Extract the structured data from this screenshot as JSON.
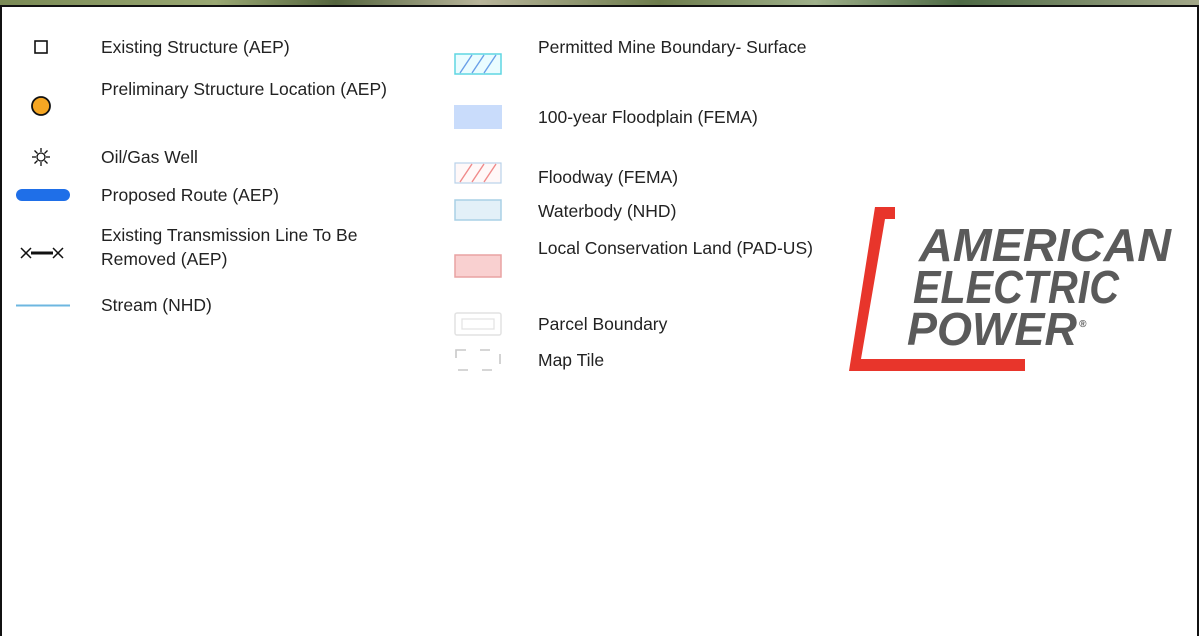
{
  "legend_left": {
    "items": [
      {
        "label": "Existing Structure (AEP)",
        "icon": "square-outline-icon"
      },
      {
        "label": "Preliminary Structure Location (AEP)",
        "icon": "orange-circle-icon"
      },
      {
        "label": "Oil/Gas Well",
        "icon": "well-sun-icon"
      },
      {
        "label": "Proposed Route (AEP)",
        "icon": "blue-route-bar-icon"
      },
      {
        "label": "Existing Transmission Line To Be Removed (AEP)",
        "icon": "x-line-x-icon"
      },
      {
        "label": "Stream (NHD)",
        "icon": "blue-line-icon"
      }
    ]
  },
  "legend_right": {
    "items": [
      {
        "label": "Permitted Mine Boundary- Surface",
        "icon": "teal-hatch-icon"
      },
      {
        "label": "100-year Floodplain (FEMA)",
        "icon": "blue-fill-icon"
      },
      {
        "label": "Floodway (FEMA)",
        "icon": "red-hatch-icon"
      },
      {
        "label": "Waterbody (NHD)",
        "icon": "light-blue-box-icon"
      },
      {
        "label": "Local Conservation Land (PAD-US)",
        "icon": "pink-box-icon"
      },
      {
        "label": "Parcel Boundary",
        "icon": "parcel-box-icon"
      },
      {
        "label": "Map Tile",
        "icon": "dashed-box-icon"
      }
    ]
  },
  "logo": {
    "lines": [
      "AMERICAN",
      "ELECTRIC",
      "POWER"
    ],
    "registered": "®"
  },
  "colors": {
    "route_blue": "#1f6fe8",
    "structure_orange": "#f5a623",
    "stream_blue": "#6db7e0",
    "floodplain_fill": "#c9dcfb",
    "waterbody_fill": "#e3f0f8",
    "waterbody_border": "#a9d0e6",
    "conservation_fill": "#f9d0d0",
    "conservation_border": "#e9a2a2",
    "logo_red": "#e8352b",
    "logo_gray": "#5a5a5a"
  }
}
